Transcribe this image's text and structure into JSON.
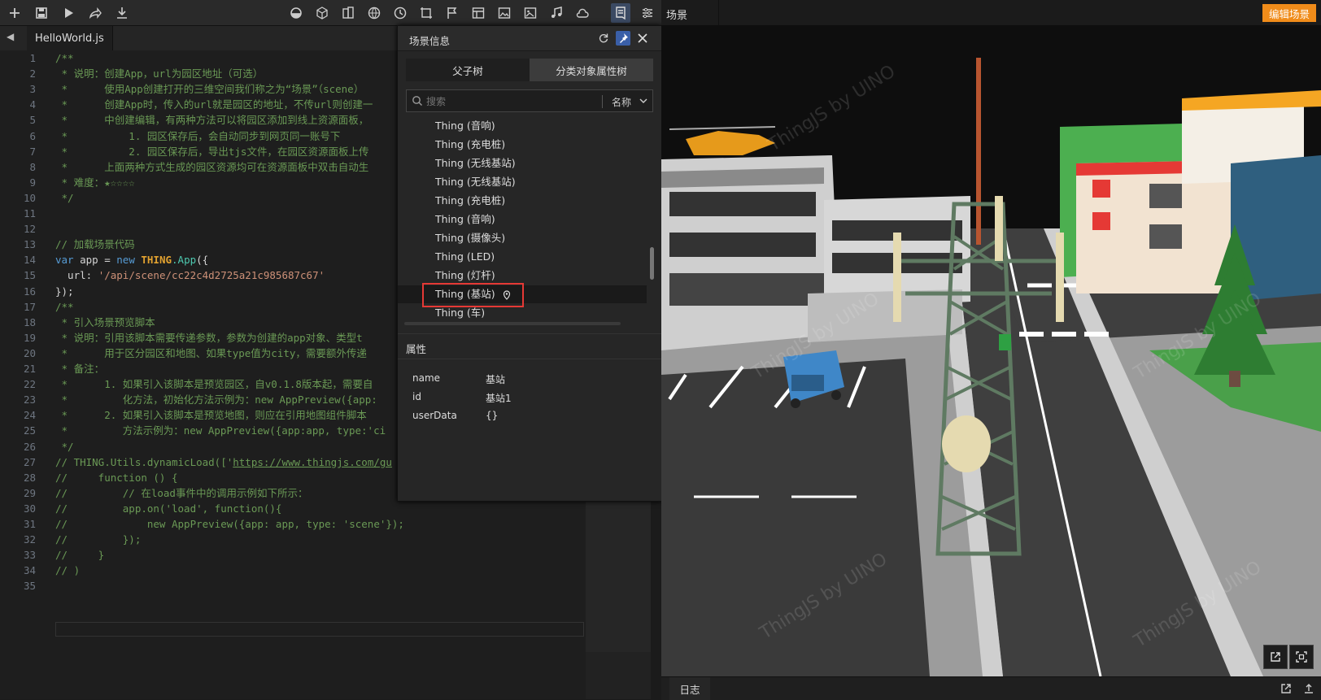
{
  "toolbar": {
    "left_icons": [
      "plus-icon",
      "save-icon",
      "play-icon",
      "share-icon",
      "download-icon"
    ],
    "right_icons": [
      "camera-icon",
      "cube-icon",
      "building-icon",
      "globe-icon",
      "clock-icon",
      "effect-icon",
      "flag-icon",
      "panel-icon",
      "image-icon",
      "picture-icon",
      "music-icon",
      "cloud-icon",
      "scene-info-icon",
      "settings-icon"
    ]
  },
  "editor": {
    "tab_label": "HelloWorld.js",
    "lines": [
      "/**",
      " * 说明：创建App，url为园区地址（可选）",
      " *      使用App创建打开的三维空间我们称之为“场景”（scene）",
      " *      创建App时，传入的url就是园区的地址，不传url则创建一",
      " *      中创建编辑，有两种方法可以将园区添加到线上资源面板，",
      " *          1. 园区保存后，会自动同步到网页同一账号下",
      " *          2. 园区保存后，导出tjs文件，在园区资源面板上传",
      " *      上面两种方式生成的园区资源均可在资源面板中双击自动生",
      " * 难度：★☆☆☆☆",
      " */",
      "",
      "",
      "// 加载场景代码",
      "var app = new THING.App({",
      "  url: '/api/scene/cc22c4d2725a21c985687c67'",
      "});",
      "/**",
      " * 引入场景预览脚本",
      " * 说明：引用该脚本需要传递参数，参数为创建的app对象、类型t",
      " *      用于区分园区和地图、如果type值为city，需要额外传递",
      " * 备注：",
      " *      1. 如果引入该脚本是预览园区，自v0.1.8版本起，需要自",
      " *         化方法，初始化方法示例为：new AppPreview({app:",
      " *      2. 如果引入该脚本是预览地图，则应在引用地图组件脚本",
      " *         方法示例为：new AppPreview({app:app, type:'ci",
      " */",
      "// THING.Utils.dynamicLoad(['https://www.thingjs.com/gu",
      "//     function () {",
      "//         // 在load事件中的调用示例如下所示：",
      "//         app.on('load', function(){",
      "//             new AppPreview({app: app, type: 'scene'});",
      "//         });",
      "//     }",
      "// )",
      ""
    ],
    "code_parts": {
      "kw_var": "var",
      "app": " app = ",
      "kw_new": "new",
      "thing": "THING",
      "dot_app": ".App",
      "open": "({",
      "url_key": "  url: ",
      "url_val": "'/api/scene/cc22c4d2725a21c985687c67'",
      "link": "https://www.thingjs.com/gu"
    }
  },
  "scene_panel": {
    "title": "场景信息",
    "tabs": [
      "父子树",
      "分类对象属性树"
    ],
    "search_placeholder": "搜索",
    "search_field": "名称",
    "tree_items": [
      "Thing (音响)",
      "Thing (充电桩)",
      "Thing (无线基站)",
      "Thing (无线基站)",
      "Thing (充电桩)",
      "Thing (音响)",
      "Thing (摄像头)",
      "Thing (LED)",
      "Thing (灯杆)",
      "Thing (基站)",
      "Thing (车)"
    ],
    "selected_index": 9,
    "props_title": "属性",
    "props": [
      {
        "key": "name",
        "value": "基站"
      },
      {
        "key": "id",
        "value": "基站1"
      },
      {
        "key": "userData",
        "value": "{}"
      }
    ]
  },
  "viewport": {
    "title": "场景",
    "edit_button": "编辑场景",
    "watermark": "ThingJS by UINO",
    "log_tab": "日志"
  },
  "colors": {
    "accent_orange": "#f08c1a",
    "selection_red": "#e53935",
    "pin_blue": "#3a5fa8"
  }
}
